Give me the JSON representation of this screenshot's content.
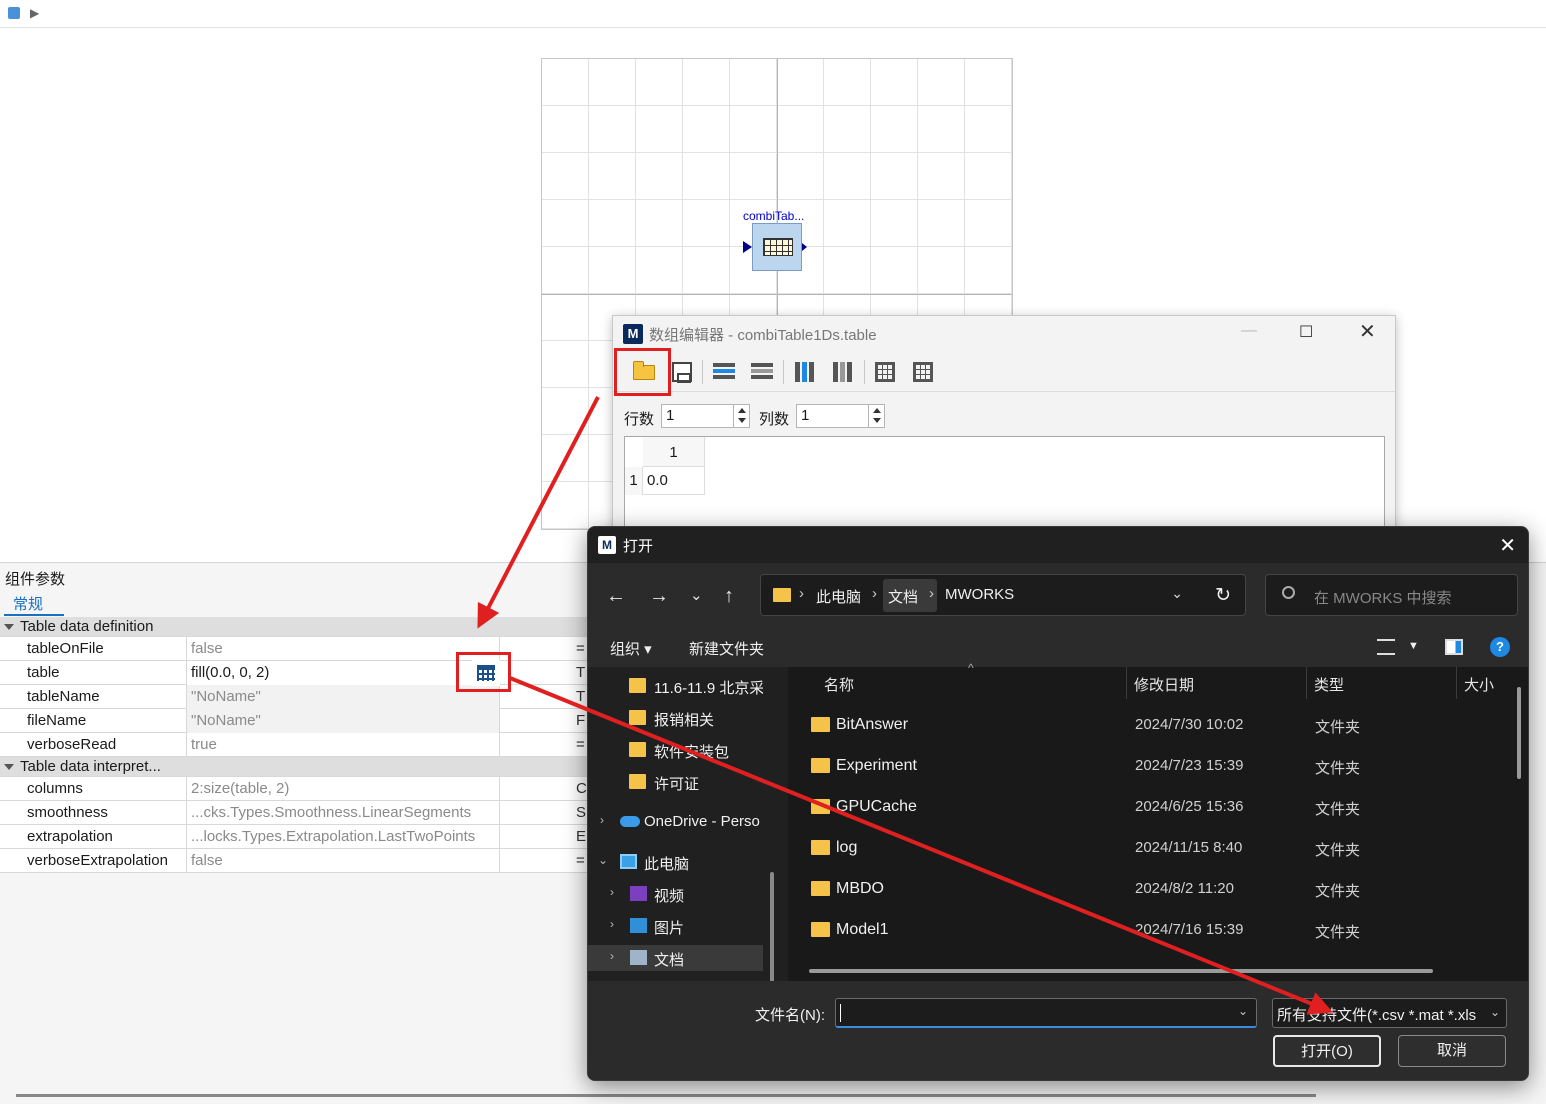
{
  "canvas": {
    "component_label": "combiTab..."
  },
  "params_panel": {
    "title": "组件参数",
    "tab": "常规",
    "groups": [
      {
        "name": "Table data definition",
        "rows": [
          {
            "name": "tableOnFile",
            "value": "false",
            "unit": "="
          },
          {
            "name": "table",
            "value": "fill(0.0, 0, 2)",
            "unit": "T"
          },
          {
            "name": "tableName",
            "value": "\"NoName\"",
            "unit": "T"
          },
          {
            "name": "fileName",
            "value": "\"NoName\"",
            "unit": "F"
          },
          {
            "name": "verboseRead",
            "value": "true",
            "unit": "="
          }
        ]
      },
      {
        "name": "Table data interpret...",
        "rows": [
          {
            "name": "columns",
            "value": "2:size(table, 2)",
            "unit": "C"
          },
          {
            "name": "smoothness",
            "value": "...cks.Types.Smoothness.LinearSegments",
            "unit": "S"
          },
          {
            "name": "extrapolation",
            "value": "...locks.Types.Extrapolation.LastTwoPoints",
            "unit": "E"
          },
          {
            "name": "verboseExtrapolation",
            "value": "false",
            "unit": "="
          }
        ]
      }
    ]
  },
  "editor": {
    "title": "数组编辑器 - combiTable1Ds.table",
    "rows_label": "行数",
    "rows_value": "1",
    "cols_label": "列数",
    "cols_value": "1",
    "grid": {
      "col_header": "1",
      "row_header": "1",
      "cell": "0.0"
    }
  },
  "open_dialog": {
    "title": "打开",
    "breadcrumb": [
      "此电脑",
      "文档",
      "MWORKS"
    ],
    "search_placeholder": "在 MWORKS 中搜索",
    "commands": {
      "organize": "组织",
      "new_folder": "新建文件夹"
    },
    "nav_items": [
      {
        "label": "11.6-11.9 北京采",
        "icon": "folder-icon"
      },
      {
        "label": "报销相关",
        "icon": "folder-icon"
      },
      {
        "label": "软件安装包",
        "icon": "folder-icon"
      },
      {
        "label": "许可证",
        "icon": "folder-icon"
      },
      {
        "label": "OneDrive - Perso",
        "icon": "cloud-icon"
      },
      {
        "label": "此电脑",
        "icon": "computer-icon"
      },
      {
        "label": "视频",
        "icon": "video-icon"
      },
      {
        "label": "图片",
        "icon": "picture-icon"
      },
      {
        "label": "文档",
        "icon": "document-icon"
      }
    ],
    "columns": {
      "name": "名称",
      "modified": "修改日期",
      "type": "类型",
      "size": "大小"
    },
    "files": [
      {
        "name": "BitAnswer",
        "modified": "2024/7/30 10:02",
        "type": "文件夹"
      },
      {
        "name": "Experiment",
        "modified": "2024/7/23 15:39",
        "type": "文件夹"
      },
      {
        "name": "GPUCache",
        "modified": "2024/6/25 15:36",
        "type": "文件夹"
      },
      {
        "name": "log",
        "modified": "2024/11/15 8:40",
        "type": "文件夹"
      },
      {
        "name": "MBDO",
        "modified": "2024/8/2 11:20",
        "type": "文件夹"
      },
      {
        "name": "Model1",
        "modified": "2024/7/16 15:39",
        "type": "文件夹"
      }
    ],
    "filename_label": "文件名(N):",
    "filename_value": "",
    "filetype_value": "所有支持文件(*.csv *.mat *.xls",
    "open_button": "打开(O)",
    "cancel_button": "取消"
  },
  "colors": {
    "annotation_red": "#e02020",
    "dialog_bg": "#202020",
    "accent_blue": "#1e88e5"
  }
}
